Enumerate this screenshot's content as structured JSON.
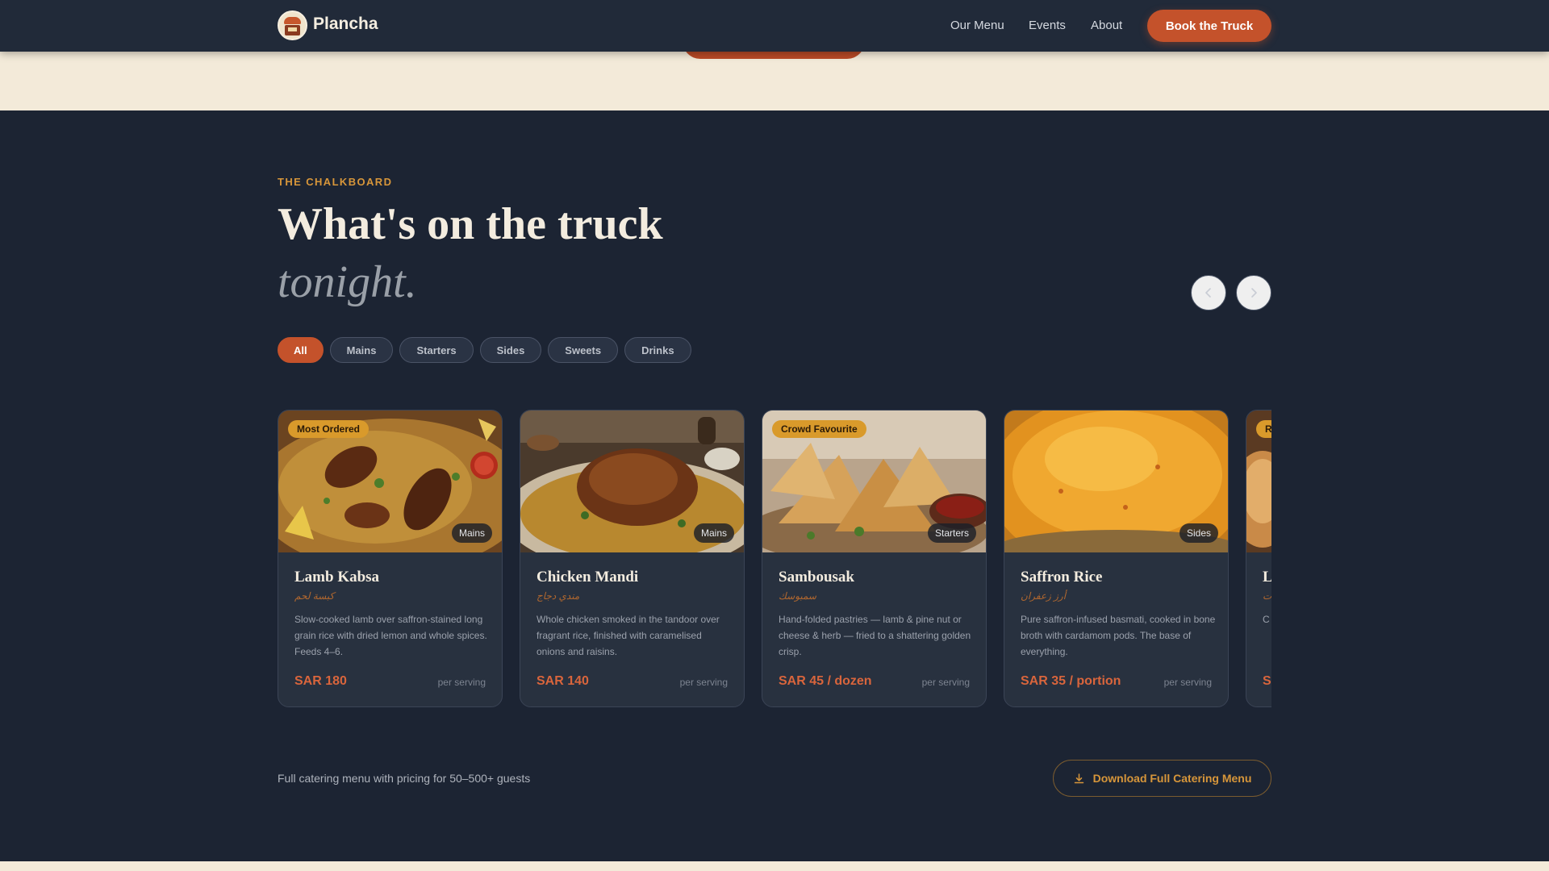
{
  "brand": {
    "name": "Plancha"
  },
  "nav": {
    "links": [
      "Our Menu",
      "Events",
      "About"
    ],
    "cta": "Book the Truck"
  },
  "section": {
    "eyebrow": "THE CHALKBOARD",
    "title_line1": "What's on the truck",
    "title_line2": "tonight."
  },
  "filters": [
    "All",
    "Mains",
    "Starters",
    "Sides",
    "Sweets",
    "Drinks"
  ],
  "active_filter": "All",
  "menu_items": [
    {
      "badge": "Most Ordered",
      "category": "Mains",
      "name": "Lamb Kabsa",
      "arabic": "كبسة لحم",
      "description": "Slow-cooked lamb over saffron-stained long grain rice with dried lemon and whole spices. Feeds 4–6.",
      "price": "SAR 180",
      "per": "per serving"
    },
    {
      "badge": "",
      "category": "Mains",
      "name": "Chicken Mandi",
      "arabic": "مندي دجاج",
      "description": "Whole chicken smoked in the tandoor over fragrant rice, finished with caramelised onions and raisins.",
      "price": "SAR 140",
      "per": "per serving"
    },
    {
      "badge": "Crowd Favourite",
      "category": "Starters",
      "name": "Sambousak",
      "arabic": "سمبوسك",
      "description": "Hand-folded pastries — lamb & pine nut or cheese & herb — fried to a shattering golden crisp.",
      "price": "SAR 45 / dozen",
      "per": "per serving"
    },
    {
      "badge": "",
      "category": "Sides",
      "name": "Saffron Rice",
      "arabic": "أرز زعفران",
      "description": "Pure saffron-infused basmati, cooked in bone broth with cardamom pods. The base of everything.",
      "price": "SAR 35 / portion",
      "per": "per serving"
    },
    {
      "badge": "R",
      "category": "",
      "name": "L",
      "arabic": "ت",
      "description": "C m th",
      "price": "S",
      "per": ""
    }
  ],
  "footer": {
    "note": "Full catering menu with pricing for 50–500+ guests",
    "download": "Download Full Catering Menu"
  },
  "colors": {
    "accent": "#c4522b",
    "gold": "#d7963a",
    "section_bg": "#1c2433",
    "nav_bg": "#212a39",
    "cream": "#f3ead9"
  }
}
